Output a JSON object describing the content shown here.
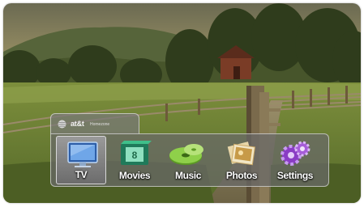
{
  "brand": {
    "name": "at&t",
    "product": "Homezone",
    "logo_icon": "globe-icon"
  },
  "menu": {
    "selected": "TV",
    "items": [
      {
        "label": "TV",
        "icon": "television-icon"
      },
      {
        "label": "Movies",
        "icon": "film-icon"
      },
      {
        "label": "Music",
        "icon": "cd-icon"
      },
      {
        "label": "Photos",
        "icon": "photo-stack-icon"
      },
      {
        "label": "Settings",
        "icon": "gears-icon"
      }
    ]
  },
  "colors": {
    "panel": "#6a6a6a",
    "selected_highlight": "#8c8c8c",
    "tv_icon": "#4f86d0",
    "movies_icon": "#2aa37a",
    "music_icon": "#7ec23a",
    "photos_icon": "#c8a25a",
    "settings_icon": "#9b4fd0"
  }
}
